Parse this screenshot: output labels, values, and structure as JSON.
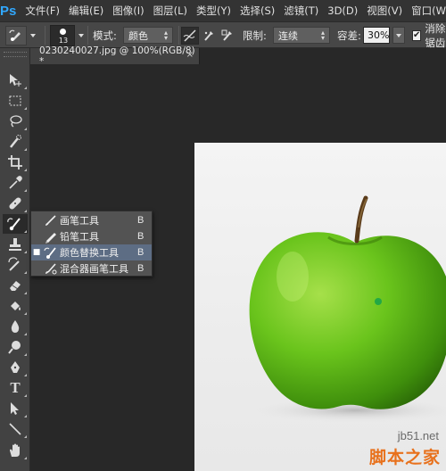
{
  "app": {
    "logo": "Ps"
  },
  "menu": [
    "文件(F)",
    "编辑(E)",
    "图像(I)",
    "图层(L)",
    "类型(Y)",
    "选择(S)",
    "滤镜(T)",
    "3D(D)",
    "视图(V)",
    "窗口(W)"
  ],
  "options": {
    "brush_size": "13",
    "mode_label": "模式:",
    "mode_value": "颜色",
    "limits_label": "限制:",
    "limits_value": "连续",
    "tolerance_label": "容差:",
    "tolerance_value": "30%",
    "antialias_label": "消除锯齿",
    "antialias_checked": true
  },
  "document": {
    "tab_title": "0230240027.jpg @ 100%(RGB/8) *",
    "close_glyph": "×"
  },
  "toolbar": {
    "tools": [
      "move-tool",
      "marquee-tool",
      "lasso-tool",
      "quick-selection-tool",
      "crop-tool",
      "eyedropper-tool",
      "healing-brush-tool",
      "brush-tool",
      "clone-stamp-tool",
      "history-brush-tool",
      "eraser-tool",
      "gradient-tool",
      "blur-tool",
      "dodge-tool",
      "pen-tool",
      "type-tool",
      "path-selection-tool",
      "rectangle-tool",
      "hand-tool"
    ],
    "type_tool_glyph": "T",
    "selected": "brush-tool"
  },
  "flyout": {
    "items": [
      {
        "label": "画笔工具",
        "key": "B",
        "active": false
      },
      {
        "label": "铅笔工具",
        "key": "B",
        "active": false
      },
      {
        "label": "颜色替换工具",
        "key": "B",
        "active": true
      },
      {
        "label": "混合器画笔工具",
        "key": "B",
        "active": false
      }
    ],
    "active_marker": "■"
  },
  "watermark": {
    "site": "jb51.net",
    "name": "脚本之家"
  },
  "colors": {
    "apple_green": "#6ac41c",
    "ps_blue": "#31a8ff",
    "watermark_orange": "#e8711c",
    "highlight": "#5d6d84"
  }
}
